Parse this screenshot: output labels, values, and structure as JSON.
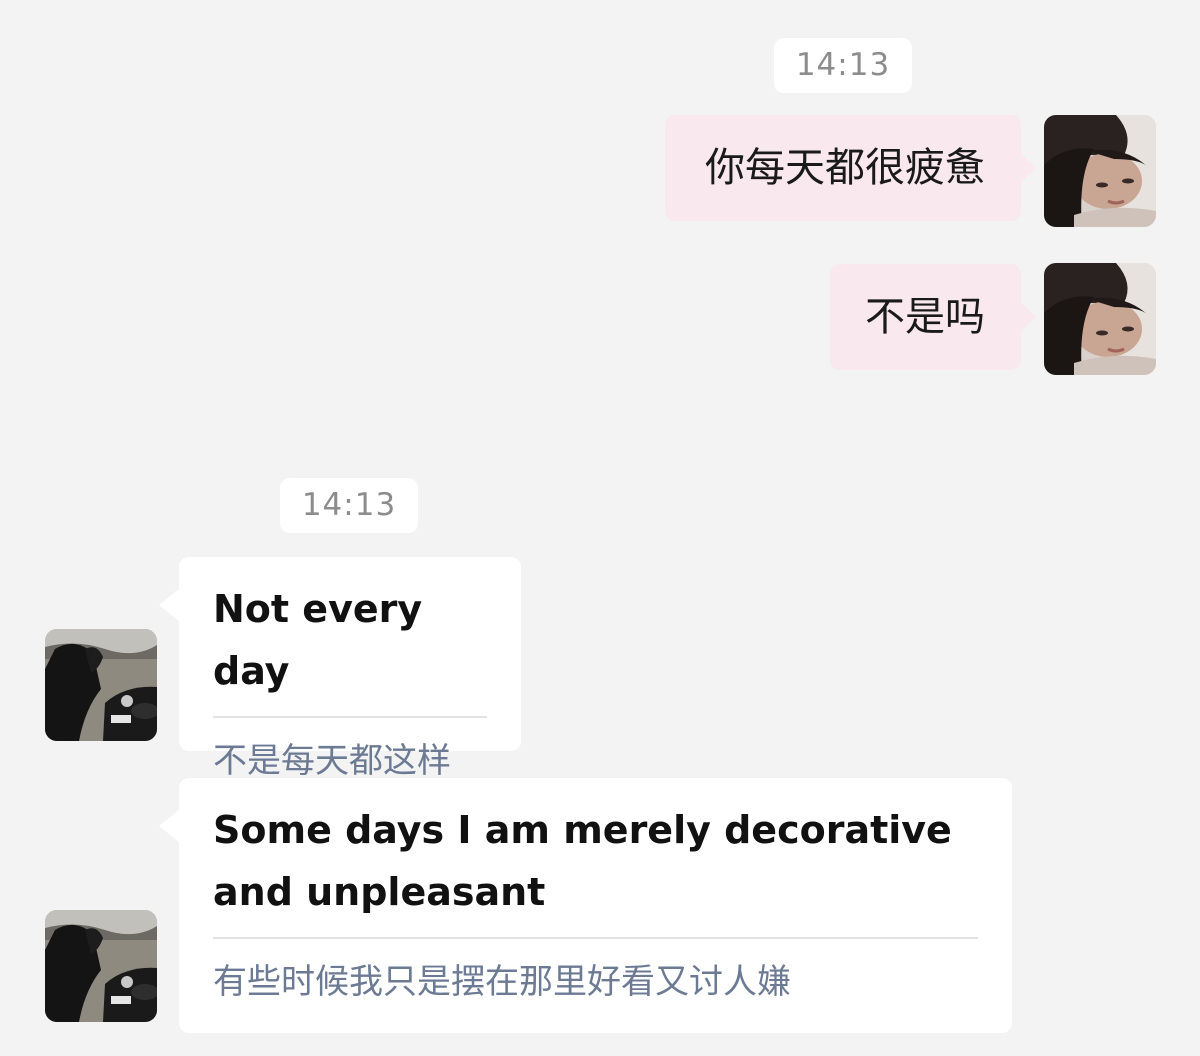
{
  "timestamps": {
    "first": "14:13",
    "second": "14:13"
  },
  "outgoing": [
    {
      "text": "你每天都很疲惫"
    },
    {
      "text": "不是吗"
    }
  ],
  "incoming": [
    {
      "original": "Not every day",
      "translation": "不是每天都这样"
    },
    {
      "original": "Some days I am merely decorative and unpleasant",
      "translation": "有些时候我只是摆在那里好看又讨人嫌"
    }
  ],
  "colors": {
    "background": "#f3f3f3",
    "outgoing_bubble": "#f9e8ee",
    "incoming_bubble": "#ffffff",
    "translation_text": "#6c7a94",
    "timestamp_text": "#8c8c8c"
  },
  "icons": {
    "my_avatar": "avatar-photo-girl",
    "contact_avatar": "avatar-photo-horse-car"
  }
}
